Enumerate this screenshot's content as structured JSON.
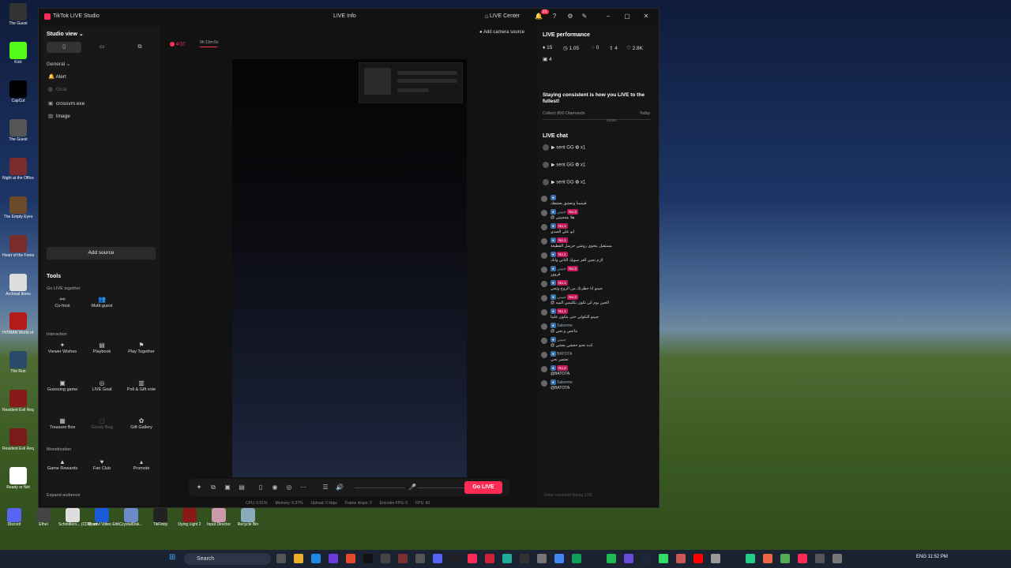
{
  "desktop": {
    "left_icons": [
      {
        "label": "The Guest",
        "color": "#333"
      },
      {
        "label": "Kick",
        "color": "#53fc18"
      },
      {
        "label": "CapCut",
        "color": "#000"
      },
      {
        "label": "The Guest",
        "color": "#555"
      },
      {
        "label": "Night at the Office",
        "color": "#7a2b2b"
      },
      {
        "label": "The Empty Eyes",
        "color": "#6a4a2a"
      },
      {
        "label": "Heart of the Forest",
        "color": "#7a2b2b"
      },
      {
        "label": "Archival Items",
        "color": "#ddd"
      },
      {
        "label": "HITMAN World of A.",
        "color": "#b31b1b"
      },
      {
        "label": "The Run",
        "color": "#2a4a6a"
      },
      {
        "label": "Resident Evil Requiem",
        "color": "#8a1a1a"
      },
      {
        "label": "Resident Evil Requiem",
        "color": "#7a1a1a"
      },
      {
        "label": "Ready or Not",
        "color": "#fff"
      }
    ],
    "bottom_icons": [
      {
        "label": "Discord",
        "color": "#5865f2"
      },
      {
        "label": "Ethel",
        "color": "#444"
      },
      {
        "label": "Schindlers... (CD1).srt",
        "color": "#ddd"
      },
      {
        "label": "Movavi Video Edit...",
        "color": "#1a5ad7"
      },
      {
        "label": "CrystalDisk...",
        "color": "#6a8ac9"
      },
      {
        "label": "TikFinity",
        "color": "#222"
      },
      {
        "label": "Dying Light 2",
        "color": "#8a1a1a"
      },
      {
        "label": "Input Director",
        "color": "#c9a"
      },
      {
        "label": "Recycle Bin",
        "color": "#8ab"
      }
    ]
  },
  "window": {
    "app_title": "TikTok LIVE Studio",
    "center_title": "LIVE Info",
    "live_center": "LIVE Center",
    "notification_count": "21"
  },
  "sidebar": {
    "view_label": "Studio view",
    "section": "General",
    "sources": [
      {
        "label": "Alert",
        "dim": false
      },
      {
        "label": "Goal",
        "dim": true
      },
      {
        "label": "crossvm.exe",
        "dim": false
      },
      {
        "label": "Image",
        "dim": false
      }
    ],
    "add_source": "Add source",
    "tools_title": "Tools",
    "go_live_together": "Go LIVE together",
    "cohost": "Co-host",
    "multiguest": "Multi-guest",
    "interaction": "Interaction",
    "viewer_wishes": "Viewer Wishes",
    "playbook": "Playbook",
    "play_together": "Play Together",
    "guessing_game": "Guessing game",
    "live_goal": "LIVE Goal",
    "poll_gift_vote": "Poll & Gift vote",
    "treasure_box": "Treasure Box",
    "goody_bag": "Goody Bag",
    "gift_gallery": "Gift Gallery",
    "monetization": "Monetization",
    "game_rewards": "Game Rewards",
    "fan_club": "Fan Club",
    "promote": "Promote",
    "expand_audience": "Expand audience"
  },
  "center": {
    "viewer_count": "4/10",
    "timer": "9h:13m:5s",
    "add_camera": "Add camera source",
    "go_live": "Go LIVE",
    "stats": [
      "CPU: 0.51%",
      "Memory: 0.37%",
      "Upload: 0 kbps",
      "Frame drops: 0",
      "Encoder FPS: 0",
      "FPS: 60"
    ]
  },
  "right": {
    "perf_title": "LIVE performance",
    "metrics": [
      "15",
      "1.05",
      "0",
      "4",
      "2.8K",
      "4"
    ],
    "goal_text": "Staying consistent is how you LIVE to the fullest!",
    "goal_sub": "Collect 800 Diamonds",
    "goal_date": "Today",
    "goal_count": "14/800",
    "chat_title": "LIVE chat",
    "gifts": [
      "sent GG",
      "sent GG",
      "sent GG"
    ],
    "gift_multiplier": "x1",
    "messages": [
      {
        "user": "",
        "badge": "",
        "text": "قبيسنا ونعشق بعشقك"
      },
      {
        "user": "جبيبي",
        "badge": "No.3",
        "text": "@ هلا بشعبيتي"
      },
      {
        "user": "",
        "badge": "No.1",
        "text": "ابو علي العبدي"
      },
      {
        "user": "",
        "badge": "No.1",
        "text": "مستقبل بتحوي روشي حرسل القطيعة"
      },
      {
        "user": "",
        "badge": "No.1",
        "text": "لازم تجين الغر سويك الثاني وانك"
      },
      {
        "user": "جبيبي",
        "badge": "No.3",
        "text": "قروور"
      },
      {
        "user": "",
        "badge": "No.1",
        "text": "جيبنو انا حظرتك من الروح وتجي"
      },
      {
        "user": "جبيبي",
        "badge": "No.3",
        "text": "@ الحين يوم كي تكون بكليبس الميه"
      },
      {
        "user": "",
        "badge": "No.1",
        "text": "جيبنو التكولي حتى بتكون علينا"
      },
      {
        "user": "Saleeme",
        "badge": "",
        "text": "@ بتاعس و تجي"
      },
      {
        "user": "جبيبي",
        "badge": "",
        "text": "@ كده نحنو حعشي بعشي"
      },
      {
        "user": "BATOTA",
        "badge": "",
        "text": "تعتصر نحي"
      },
      {
        "user": "",
        "badge": "No.2",
        "text": "@BATOTA"
      },
      {
        "user": "Saleeme",
        "badge": "",
        "text": "@BATOTA"
      }
    ],
    "chat_placeholder": "Enter comment during LIVE"
  },
  "taskbar": {
    "search": "Search",
    "tray": "ENG 11:52 PM"
  }
}
